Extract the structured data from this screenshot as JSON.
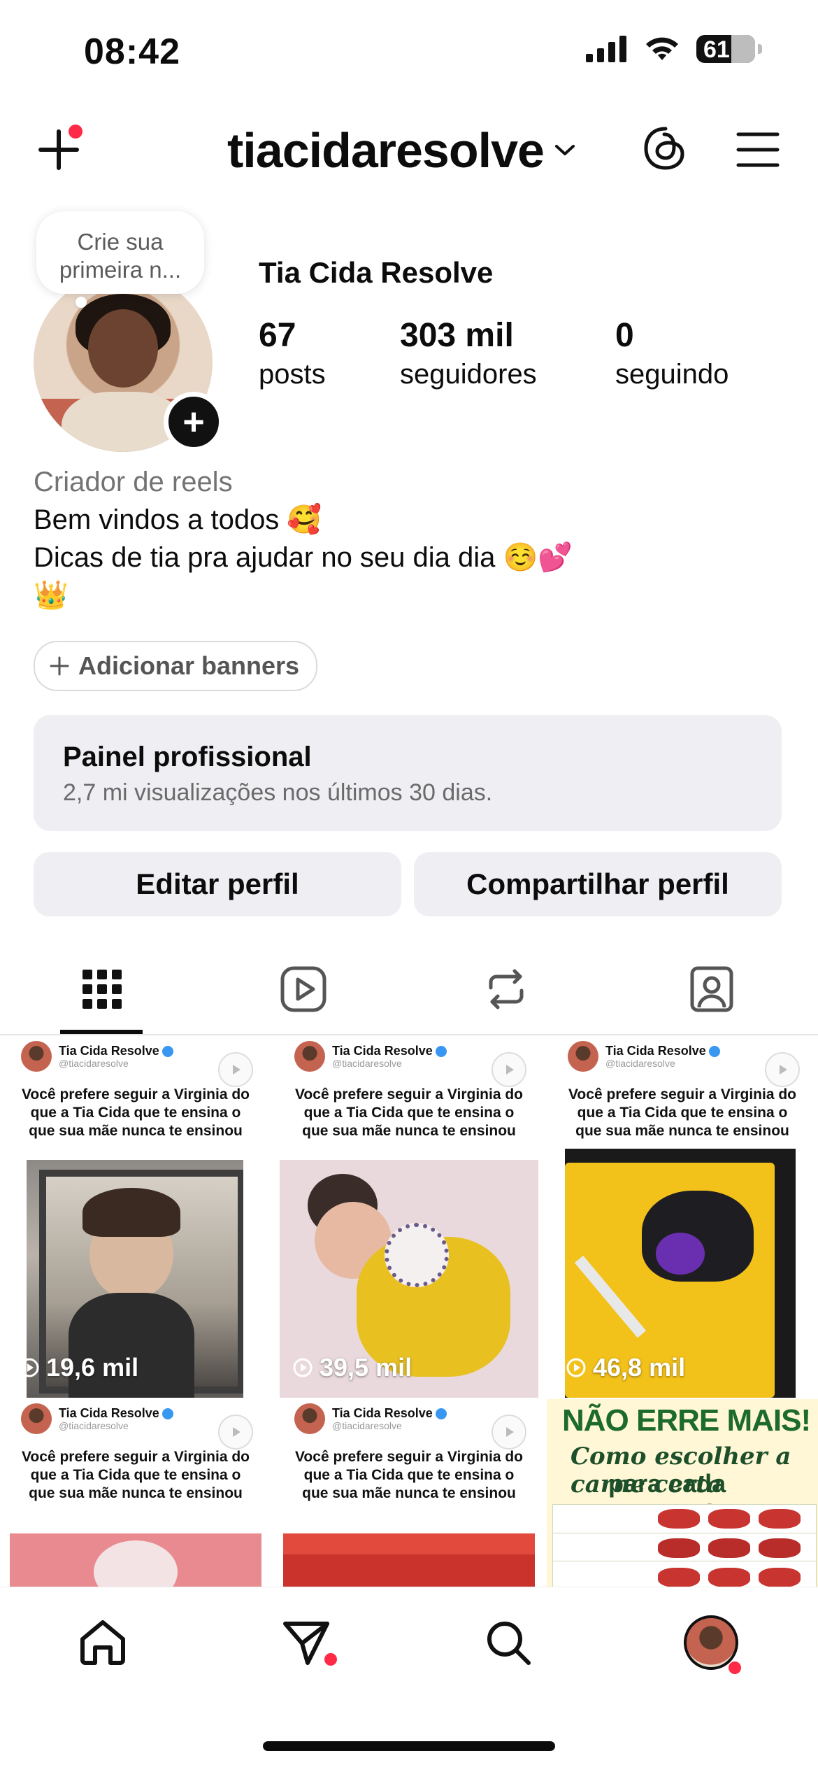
{
  "status_bar": {
    "time": "08:42",
    "battery": "61"
  },
  "header": {
    "username": "tiacidaresolve"
  },
  "profile": {
    "bubble_text_1": "Crie sua",
    "bubble_text_2": "primeira n...",
    "display_name": "Tia Cida Resolve",
    "stats": [
      {
        "value": "67",
        "label": "posts"
      },
      {
        "value": "303 mil",
        "label": "seguidores"
      },
      {
        "value": "0",
        "label": "seguindo"
      }
    ],
    "category": "Criador de reels",
    "bio_lines": [
      "Bem vindos a todos 🥰",
      "Dicas de tia pra ajudar no seu dia dia ☺️💕",
      "👑"
    ],
    "add_banners": "Adicionar banners"
  },
  "professional_panel": {
    "title": "Painel profissional",
    "subtitle": "2,7 mi visualizações nos últimos 30 dias."
  },
  "buttons": {
    "edit": "Editar perfil",
    "share": "Compartilhar perfil"
  },
  "tabs": [
    "grid-icon",
    "reels-icon",
    "reposts-icon",
    "tagged-icon"
  ],
  "posts": [
    {
      "author": "Tia Cida Resolve",
      "handle": "@tiacidaresolve",
      "caption": "Você prefere seguir a Virginia do que a Tia Cida que te ensina o que sua mãe nunca te ensinou",
      "views": "19,6 mil"
    },
    {
      "author": "Tia Cida Resolve",
      "handle": "@tiacidaresolve",
      "caption": "Você prefere seguir a Virginia do que a Tia Cida que te ensina o que sua mãe nunca te ensinou",
      "views": "39,5 mil"
    },
    {
      "author": "Tia Cida Resolve",
      "handle": "@tiacidaresolve",
      "caption": "Você prefere seguir a Virginia do que a Tia Cida que te ensina o que sua mãe nunca te ensinou",
      "views": "46,8 mil"
    },
    {
      "author": "Tia Cida Resolve",
      "handle": "@tiacidaresolve",
      "caption": "Você prefere seguir a Virginia do que a Tia Cida que te ensina o que sua mãe nunca te ensinou"
    },
    {
      "author": "Tia Cida Resolve",
      "handle": "@tiacidaresolve",
      "caption": "Você prefere seguir a Virginia do que a Tia Cida que te ensina o que sua mãe nunca te ensinou"
    }
  ],
  "carne_post": {
    "title": "NÃO ERRE MAIS!",
    "sub1": "Como escolher a carne certa",
    "sub2": "para cada preparo?"
  },
  "bottom_nav": [
    "home-icon",
    "direct-icon",
    "search-icon",
    "profile-avatar"
  ]
}
